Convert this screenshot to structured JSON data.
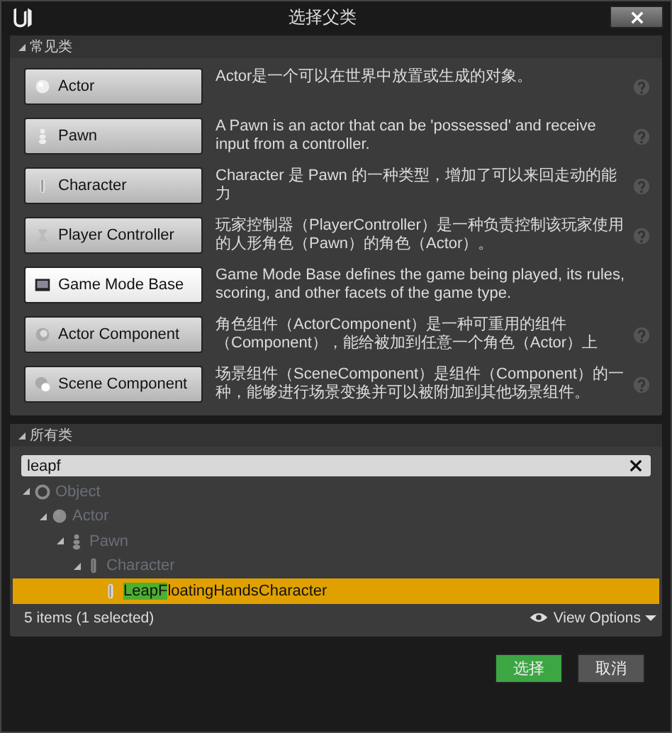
{
  "window": {
    "title": "选择父类"
  },
  "common_section": {
    "title": "常见类",
    "expanded": true,
    "classes": [
      {
        "label": "Actor",
        "kind": "sphere",
        "hovered": false,
        "help": true,
        "description": "Actor是一个可以在世界中放置或生成的对象。"
      },
      {
        "label": "Pawn",
        "kind": "pawn",
        "hovered": false,
        "help": true,
        "description": "A Pawn is an actor that can be 'possessed' and receive input from a controller."
      },
      {
        "label": "Character",
        "kind": "figure",
        "hovered": false,
        "help": true,
        "description": "Character 是 Pawn 的一种类型，增加了可以来回走动的能力"
      },
      {
        "label": "Player Controller",
        "kind": "controller",
        "hovered": false,
        "help": true,
        "description": "玩家控制器（PlayerController）是一种负责控制该玩家使用的人形角色（Pawn）的角色（Actor）。"
      },
      {
        "label": "Game Mode Base",
        "kind": "monitor",
        "hovered": true,
        "help": false,
        "description": "Game Mode Base defines the game being played, its rules, scoring, and other facets of the game type."
      },
      {
        "label": "Actor Component",
        "kind": "component",
        "hovered": false,
        "help": true,
        "description": "角色组件（ActorComponent）是一种可重用的组件（Component），能给被加到任意一个角色（Actor）上"
      },
      {
        "label": "Scene Component",
        "kind": "scene",
        "hovered": false,
        "help": true,
        "description": "场景组件（SceneComponent）是组件（Component）的一种，能够进行场景变换并可以被附加到其他场景组件。"
      }
    ]
  },
  "all_section": {
    "title": "所有类",
    "expanded": true,
    "search": {
      "value": "leapf"
    },
    "tree": [
      {
        "label": "Object",
        "kind": "ring",
        "matched": false,
        "selected": false,
        "expanded": true,
        "children": [
          {
            "label": "Actor",
            "kind": "sphere",
            "matched": false,
            "selected": false,
            "expanded": true,
            "children": [
              {
                "label": "Pawn",
                "kind": "pawn",
                "matched": false,
                "selected": false,
                "expanded": true,
                "children": [
                  {
                    "label": "Character",
                    "kind": "figure",
                    "matched": false,
                    "selected": false,
                    "expanded": true,
                    "children": [
                      {
                        "label_match": "LeapF",
                        "label_rest": "loatingHandsCharacter",
                        "kind": "figure",
                        "matched": true,
                        "selected": true
                      }
                    ]
                  }
                ]
              }
            ]
          }
        ]
      }
    ],
    "status": "5 items (1 selected)",
    "view_options": "View Options"
  },
  "buttons": [
    {
      "label": "选择",
      "kind": "primary"
    },
    {
      "label": "取消",
      "kind": "secondary"
    }
  ]
}
